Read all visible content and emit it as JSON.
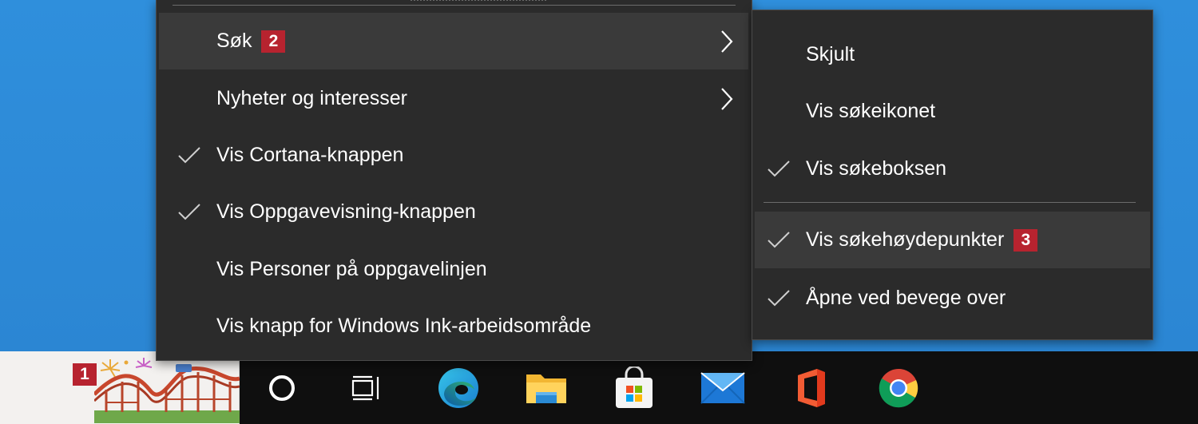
{
  "context_menu": {
    "items": [
      {
        "label": "Søk",
        "badge": "2",
        "checked": false,
        "has_submenu": true,
        "highlighted": true
      },
      {
        "label": "Nyheter og interesser",
        "checked": false,
        "has_submenu": true,
        "highlighted": false
      },
      {
        "label": "Vis Cortana-knappen",
        "checked": true,
        "has_submenu": false,
        "highlighted": false
      },
      {
        "label": "Vis Oppgavevisning-knappen",
        "checked": true,
        "has_submenu": false,
        "highlighted": false
      },
      {
        "label": "Vis Personer på oppgavelinjen",
        "checked": false,
        "has_submenu": false,
        "highlighted": false
      },
      {
        "label": "Vis knapp for Windows Ink-arbeidsområde",
        "checked": false,
        "has_submenu": false,
        "highlighted": false
      }
    ]
  },
  "submenu": {
    "items": [
      {
        "label": "Skjult",
        "checked": false,
        "highlighted": false
      },
      {
        "label": "Vis søkeikonet",
        "checked": false,
        "highlighted": false
      },
      {
        "label": "Vis søkeboksen",
        "checked": true,
        "highlighted": false
      },
      {
        "label": "Vis søkehøydepunkter",
        "badge": "3",
        "checked": true,
        "highlighted": true
      },
      {
        "label": "Åpne ved bevege over",
        "checked": true,
        "highlighted": false
      }
    ]
  },
  "taskbar": {
    "search_highlight_badge": "1",
    "icons": [
      "search-highlight-doodle",
      "cortana-icon",
      "task-view-icon",
      "edge-icon",
      "file-explorer-icon",
      "microsoft-store-icon",
      "mail-icon",
      "office-icon",
      "chrome-icon"
    ]
  },
  "colors": {
    "desktop": "#2b86d3",
    "menu_bg": "#2b2b2b",
    "menu_hover": "#3a3a3a",
    "badge": "#b7232f",
    "taskbar": "#0f0f0f"
  }
}
